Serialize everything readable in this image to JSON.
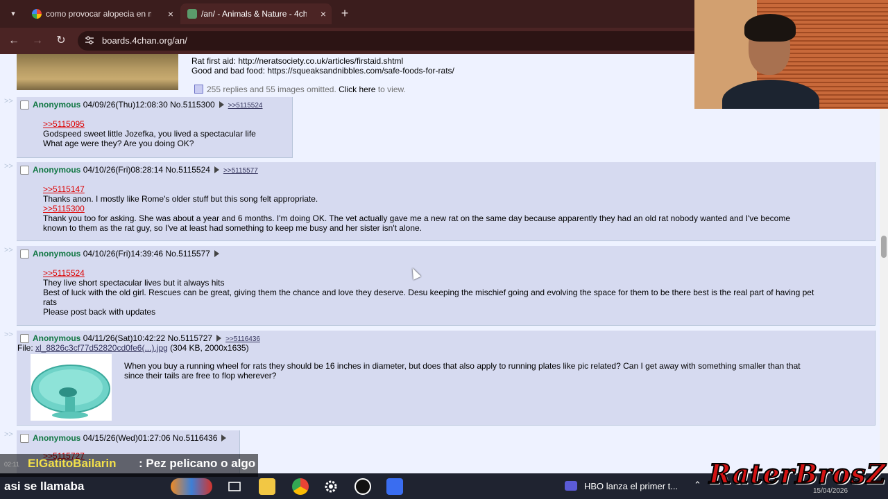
{
  "browser": {
    "tabs": [
      {
        "title": "como provocar alopecia en mi",
        "active": false
      },
      {
        "title": "/an/ - Animals & Nature - 4cha",
        "active": true
      }
    ],
    "close_glyph": "×",
    "new_tab_glyph": "+",
    "url": "boards.4chan.org/an/"
  },
  "op": {
    "lines": [
      "Rat first aid: http://neratsociety.co.uk/articles/firstaid.shtml",
      "Good and bad food: https://squeaksandnibbles.com/safe-foods-for-rats/"
    ],
    "omitted_prefix": "255 replies and 55 images omitted.",
    "omitted_click": "Click here",
    "omitted_suffix": "to view."
  },
  "replies": [
    {
      "name": "Anonymous",
      "datetime": "04/09/26(Thu)12:08:30",
      "number": "No.5115300",
      "backlinks": ">>5115524",
      "lines": [
        {
          "text": ">>5115095",
          "quote": true
        },
        {
          "text": "Godspeed sweet little Jozefka, you lived a spectacular life",
          "quote": false
        },
        {
          "text": "What age were they? Are you doing OK?",
          "quote": false
        }
      ]
    },
    {
      "name": "Anonymous",
      "datetime": "04/10/26(Fri)08:28:14",
      "number": "No.5115524",
      "backlinks": ">>5115577",
      "lines": [
        {
          "text": ">>5115147",
          "quote": true
        },
        {
          "text": "Thanks anon. I mostly like Rome's older stuff but this song felt appropriate.",
          "quote": false
        },
        {
          "text": ">>5115300",
          "quote": true
        },
        {
          "text": "Thank you too for asking. She was about a year and 6 months. I'm doing OK. The vet actually gave me a new rat on the same day because apparently they had an old rat nobody wanted and I've become\nknown to them as the rat guy, so I've at least had something to keep me busy and her sister isn't alone.",
          "quote": false
        }
      ]
    },
    {
      "name": "Anonymous",
      "datetime": "04/10/26(Fri)14:39:46",
      "number": "No.5115577",
      "backlinks": "",
      "lines": [
        {
          "text": ">>5115524",
          "quote": true
        },
        {
          "text": "They live short spectacular lives but it always hits",
          "quote": false
        },
        {
          "text": "Best of luck with the old girl. Rescues can be great, giving them the chance and love they deserve. Desu keeping the mischief going and evolving the space for them to be there best is the real part of having pet\nrats",
          "quote": false
        },
        {
          "text": "Please post back with updates",
          "quote": false
        }
      ]
    },
    {
      "name": "Anonymous",
      "datetime": "04/11/26(Sat)10:42:22",
      "number": "No.5115727",
      "backlinks": ">>5116436",
      "file_label": "File:",
      "file_name": "xl_8826c3cf77d52820cd0fe6(...).jpg",
      "file_meta": "(304 KB, 2000x1635)",
      "lines": [
        {
          "text": "When you buy a running wheel for rats they should be 16 inches in diameter, but does that also apply to running plates like pic related? Can I get away with something smaller than that\nsince their tails are free to flop wherever?",
          "quote": false
        }
      ]
    },
    {
      "name": "Anonymous",
      "datetime": "04/15/26(Wed)01:27:06",
      "number": "No.5116436",
      "backlinks": "",
      "lines": [
        {
          "text": ">>5115727",
          "quote": true
        }
      ]
    }
  ],
  "stream": {
    "chat_timestamp": "02:11",
    "chat_user": "ElGatitoBailarin",
    "chat_message": ": Pez pelicano o algo",
    "chat_continuation": "asi se llamaba",
    "logo_text": "RaterBrosZ"
  },
  "taskbar": {
    "notification": "HBO lanza el primer t...",
    "date": "15/04/2026"
  },
  "colors": {
    "tabstrip": "#3b1d1d",
    "toolbar": "#4b2424",
    "page_bg": "#eef2ff",
    "reply_bg": "#d6daf0",
    "name_green": "#117743",
    "quote_red": "#dd0000"
  }
}
